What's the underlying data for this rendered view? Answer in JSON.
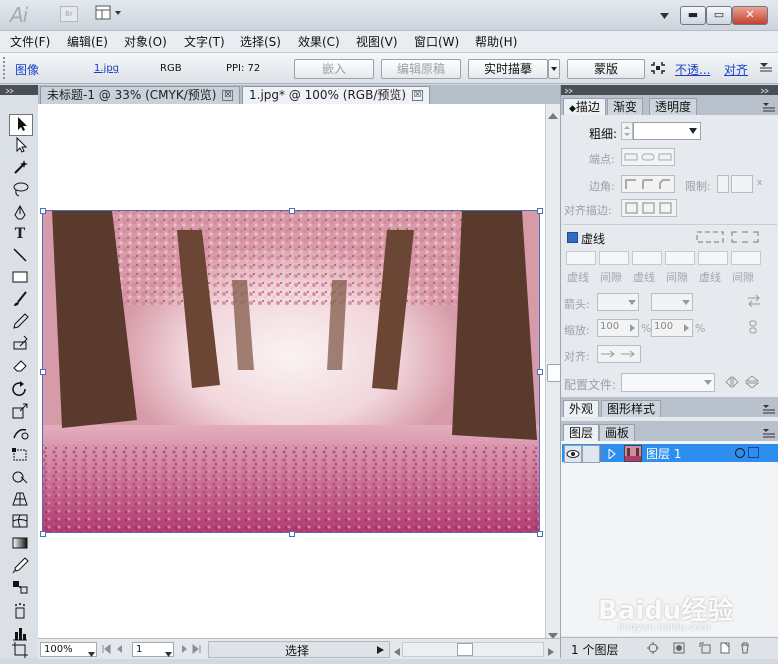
{
  "app": {
    "logo": "Ai",
    "bridge_label": "Br"
  },
  "window_controls": {
    "minimize": "▬",
    "restore": "▭",
    "close": "✕"
  },
  "menu": [
    "文件(F)",
    "编辑(E)",
    "对象(O)",
    "文字(T)",
    "选择(S)",
    "效果(C)",
    "视图(V)",
    "窗口(W)",
    "帮助(H)"
  ],
  "control_bar": {
    "object_type": "图像",
    "file_name": "1.jpg",
    "color_mode": "RGB",
    "ppi": "PPI: 72",
    "embed_button": "嵌入",
    "edit_original_button": "编辑原稿",
    "live_trace_button": "实时描摹",
    "mask_button": "蒙版",
    "opacity_link": "不透...",
    "align_link": "对齐"
  },
  "document_tabs": [
    {
      "label": "未标题-1 @ 33% (CMYK/预览)",
      "close": "☒"
    },
    {
      "label": "1.jpg* @ 100% (RGB/预览)",
      "close": "☒"
    }
  ],
  "status_bar": {
    "zoom": "100%",
    "artboard": "1",
    "selection_label": "选择"
  },
  "stroke_panel": {
    "tabs": [
      "描边",
      "渐变",
      "透明度"
    ],
    "weight_label": "粗细:",
    "cap_label": "端点:",
    "corner_label": "边角:",
    "limit_label": "限制:",
    "limit_unit": "x",
    "align_stroke_label": "对齐描边:",
    "dashed_label": "虚线",
    "dash_labels": [
      "虚线",
      "间隙",
      "虚线",
      "间隙",
      "虚线",
      "间隙"
    ],
    "arrow_label": "箭头:",
    "scale_label": "缩放:",
    "scale_left": "100",
    "scale_right": "100",
    "percent": "%",
    "align_label": "对齐:",
    "profile_label": "配置文件:"
  },
  "appearance_panel": {
    "tabs": [
      "外观",
      "图形样式"
    ]
  },
  "layers_panel": {
    "tabs": [
      "图层",
      "画板"
    ],
    "layer_name": "图层 1",
    "footer_count": "1 个图层"
  },
  "watermark": {
    "main": "Baidu经验",
    "sub": "jingyan.baidu.com"
  },
  "colors": {
    "selection_blue": "#2d8ef0",
    "link_blue": "#1a3fc4",
    "dark_grip": "#4a4f57"
  }
}
